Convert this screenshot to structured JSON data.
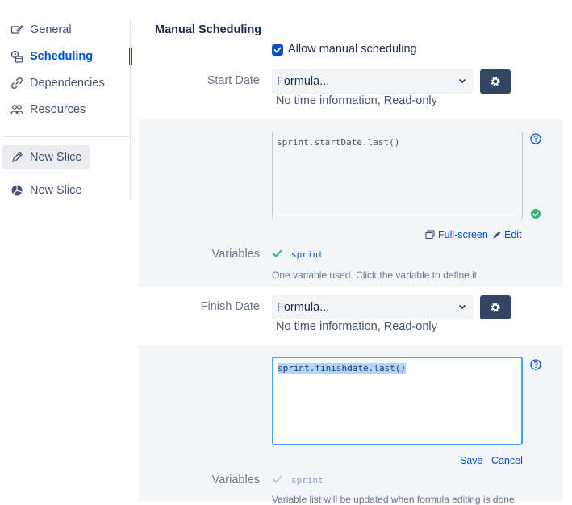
{
  "sidebar": {
    "items": [
      {
        "label": "General",
        "icon": "edit-settings-icon"
      },
      {
        "label": "Scheduling",
        "icon": "calendar-icon"
      },
      {
        "label": "Dependencies",
        "icon": "link-icon"
      },
      {
        "label": "Resources",
        "icon": "people-icon"
      }
    ],
    "slices": [
      {
        "label": "New Slice",
        "icon": "pencil-icon"
      },
      {
        "label": "New Slice",
        "icon": "pie-chart-icon"
      }
    ]
  },
  "main": {
    "section_title": "Manual Scheduling",
    "allow_manual": {
      "label": "Allow manual scheduling",
      "checked": true
    },
    "start_date": {
      "label": "Start Date",
      "select_value": "Formula...",
      "info": "No time information, Read-only",
      "formula": "sprint.startDate.last()",
      "fullscreen_label": "Full-screen",
      "edit_label": "Edit",
      "variables_label": "Variables",
      "variable": "sprint",
      "variables_note": "One variable used. Click the variable to define it."
    },
    "finish_date": {
      "label": "Finish Date",
      "select_value": "Formula...",
      "info": "No time information, Read-only",
      "formula": "sprint.finishdate.last()",
      "save_label": "Save",
      "cancel_label": "Cancel",
      "variables_label": "Variables",
      "variable": "sprint",
      "variables_note": "Variable list will be updated when formula editing is done."
    }
  },
  "colors": {
    "accent": "#0052cc",
    "panel": "#f4f5f7",
    "gear_button": "#344563",
    "success": "#36b37e"
  }
}
